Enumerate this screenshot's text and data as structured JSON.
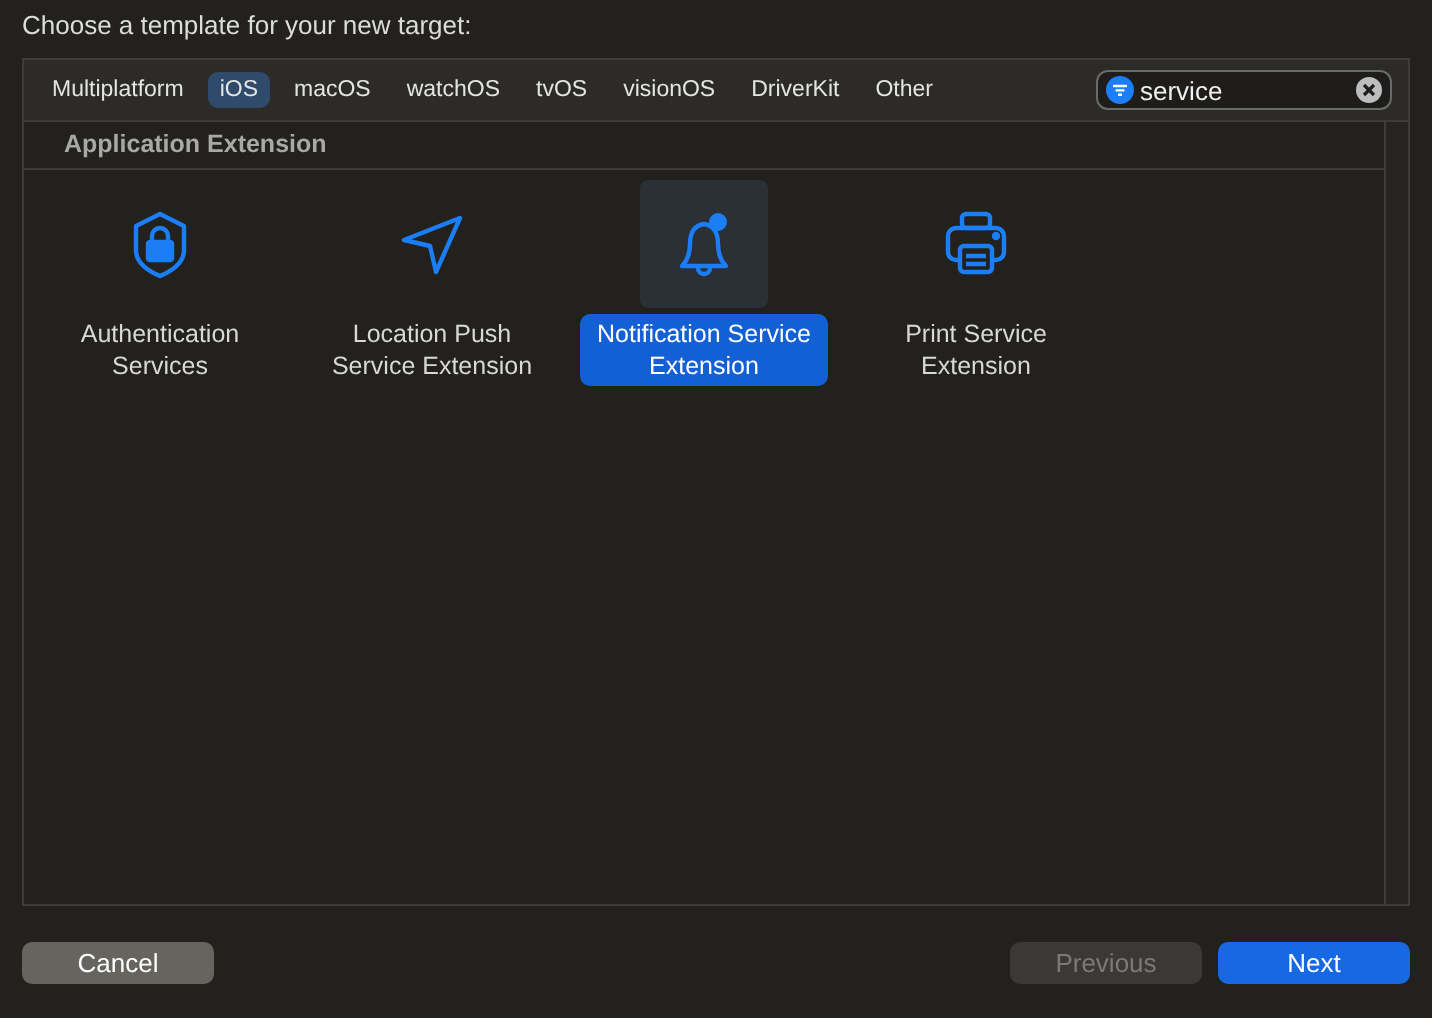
{
  "heading": "Choose a template for your new target:",
  "platforms": [
    {
      "label": "Multiplatform",
      "selected": false
    },
    {
      "label": "iOS",
      "selected": true
    },
    {
      "label": "macOS",
      "selected": false
    },
    {
      "label": "watchOS",
      "selected": false
    },
    {
      "label": "tvOS",
      "selected": false
    },
    {
      "label": "visionOS",
      "selected": false
    },
    {
      "label": "DriverKit",
      "selected": false
    },
    {
      "label": "Other",
      "selected": false
    }
  ],
  "search": {
    "value": "service"
  },
  "section": "Application Extension",
  "templates": [
    {
      "kind": "shield",
      "label": "Authentication Services",
      "selected": false
    },
    {
      "kind": "location",
      "label": "Location Push Service Extension",
      "selected": false
    },
    {
      "kind": "bell",
      "label": "Notification Service Extension",
      "selected": true
    },
    {
      "kind": "printer",
      "label": "Print Service Extension",
      "selected": false
    }
  ],
  "buttons": [
    {
      "label": "Cancel",
      "kind": "normal",
      "disabled": false
    },
    {
      "label": "Previous",
      "kind": "normal",
      "disabled": true
    },
    {
      "label": "Next",
      "kind": "primary",
      "disabled": false
    }
  ]
}
